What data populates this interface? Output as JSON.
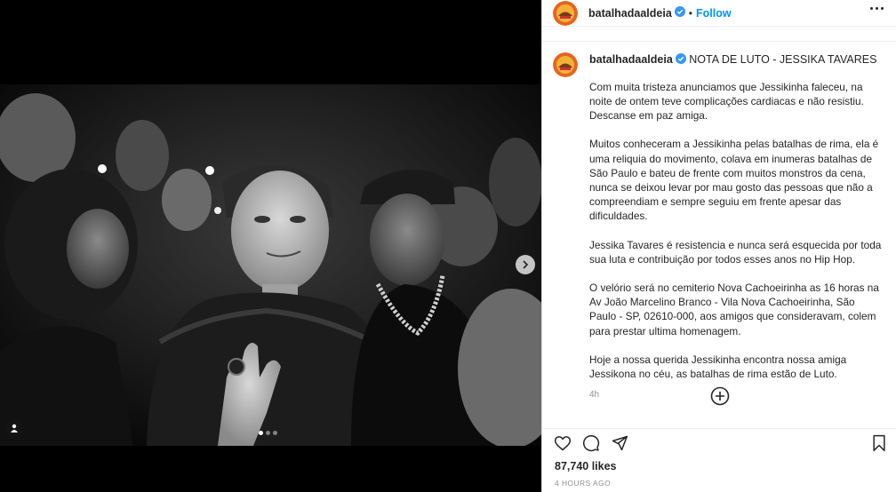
{
  "post": {
    "username": "batalhadaaldeia",
    "follow_label": "Follow",
    "separator": "•",
    "caption_title": "NOTA DE LUTO - JESSIKA TAVARES",
    "paragraphs": [
      "Com muita tristeza anunciamos que Jessikinha faleceu, na noite de ontem teve complicações cardiacas e não resistiu. Descanse em paz amiga.",
      "Muitos conheceram a Jessikinha pelas batalhas de rima, ela é uma reliquia do movimento, colava em inumeras batalhas de São Paulo e bateu de frente com muitos monstros da cena, nunca se deixou levar por mau gosto das pessoas que não a compreendiam e sempre seguiu em frente apesar das dificuldades.",
      "Jessika Tavares é resistencia e nunca será esquecida por toda sua luta e contribuição por todos esses anos no Hip Hop.",
      "O velório será no cemiterio Nova Cachoeirinha as 16 horas na Av João Marcelino Branco - Vila Nova Cachoeirinha, São Paulo - SP, 02610-000, aos amigos que consideravam, colem para prestar ultima homenagem.",
      "Hoje a nossa querida Jessikinha encontra nossa amiga Jessikona no céu, as batalhas de rima estão de Luto."
    ],
    "caption_age": "4h",
    "likes": "87,740 likes",
    "timestamp": "4 HOURS AGO"
  },
  "carousel": {
    "current": 1,
    "total": 3
  },
  "icons": {
    "verified": "verified-badge-icon",
    "more": "more-options-icon",
    "load_more": "plus-circle-icon",
    "like": "heart-icon",
    "comment": "comment-icon",
    "share": "paper-plane-icon",
    "save": "bookmark-icon",
    "next": "chevron-right-icon",
    "tags": "user-tag-icon"
  },
  "colors": {
    "accent": "#0095f6",
    "text": "#262626",
    "muted": "#8e8e8e",
    "verified": "#3897f0"
  }
}
